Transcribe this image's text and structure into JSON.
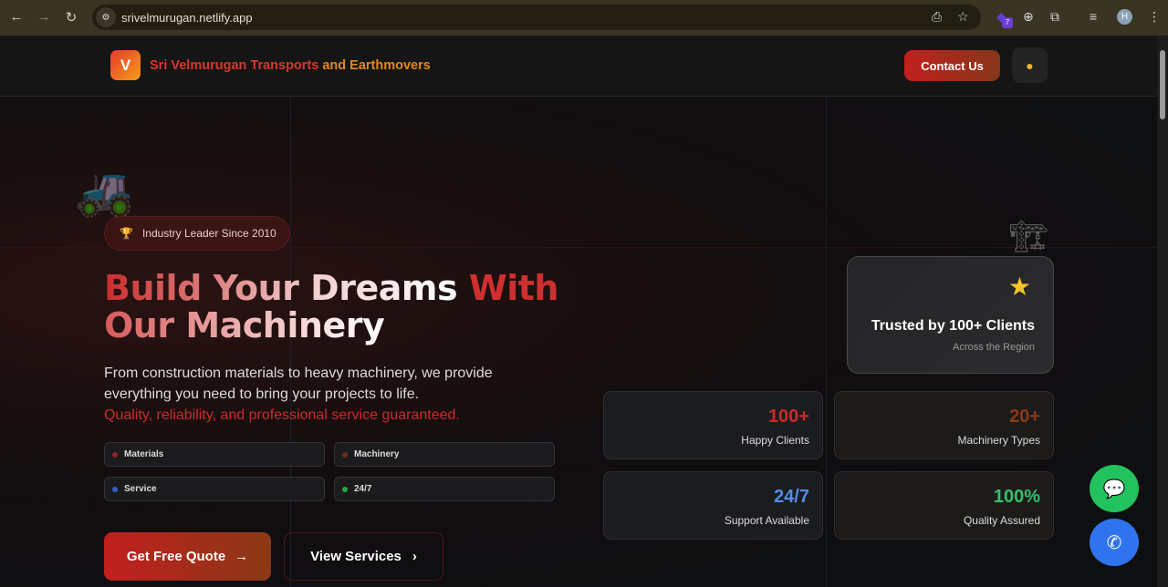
{
  "browser": {
    "url": "srivelmurugan.netlify.app",
    "extension_badge": "7",
    "profile_initial": "H"
  },
  "nav": {
    "logo_letter": "V",
    "brand_part1": "Sri Velmurugan Transports",
    "brand_part2": "and Earthmovers",
    "contact_label": "Contact Us"
  },
  "hero": {
    "badge": "Industry Leader Since 2010",
    "title_part1": "Build Your Dreams",
    "title_part2": "With",
    "title_part3": "Our Machinery",
    "description": "From construction materials to heavy machinery, we provide everything you need to bring your projects to life.",
    "highlight": "Quality, reliability, and professional service guaranteed.",
    "tags": [
      {
        "label": "Materials",
        "color": "#8e2323"
      },
      {
        "label": "Machinery",
        "color": "#6a2e1a"
      },
      {
        "label": "Service",
        "color": "#3461c4"
      },
      {
        "label": "24/7",
        "color": "#27a554"
      }
    ],
    "primary_cta": "Get Free Quote",
    "secondary_cta": "View Services"
  },
  "trust": {
    "title": "Trusted by 100+ Clients",
    "subtitle": "Across the Region"
  },
  "stats": [
    {
      "value": "100+",
      "label": "Happy Clients",
      "color": "#cf2a2a"
    },
    {
      "value": "20+",
      "label": "Machinery Types",
      "color": "#8a3a18"
    },
    {
      "value": "24/7",
      "label": "Support Available",
      "color": "#4f8fe6"
    },
    {
      "value": "100%",
      "label": "Quality Assured",
      "color": "#33c06a"
    }
  ]
}
